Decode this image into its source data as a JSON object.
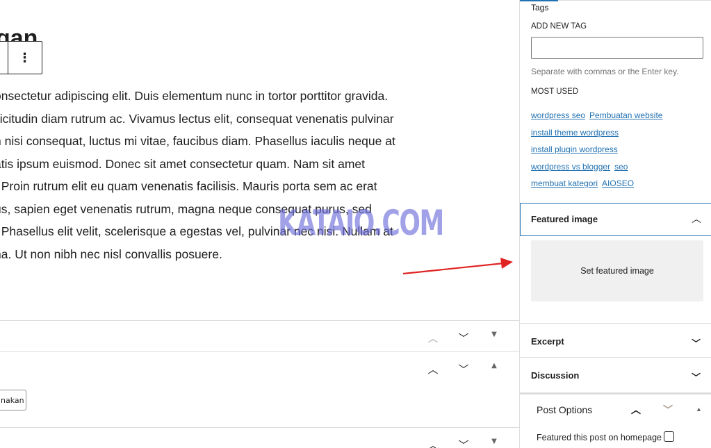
{
  "editor": {
    "title_fragment": "gan",
    "more_options_icon": "⋮",
    "paragraph_lines": [
      "onsectetur adipiscing elit. Duis elementum nunc in tortor porttitor gravida.",
      "llicitudin diam rutrum ac. Vivamus lectus elit, consequat venenatis pulvinar",
      "n nisi consequat, luctus mi vitae, faucibus diam. Phasellus iaculis neque at",
      "atis ipsum euismod. Donec sit amet consectetur quam. Nam sit amet",
      ". Proin rutrum elit eu quam venenatis facilisis. Mauris porta sem ac erat",
      "us, sapien eget venenatis rutrum, magna neque consequat purus, sed",
      ". Phasellus elit velit, scelerisque a egestas vel, pulvinar nec nisi. Nullam at",
      "na. Ut non nibh nec nisl convallis posuere."
    ],
    "watermark": "KATAIO.COM",
    "select_value": "nakan",
    "arrow_color": "#e02424"
  },
  "sidebar": {
    "tags_heading": "Tags",
    "add_new_tag_label": "ADD NEW TAG",
    "tag_input_value": "",
    "help_text": "Separate with commas or the Enter key.",
    "most_used_label": "MOST USED",
    "tag_rows": [
      [
        "wordpress seo",
        "Pembuatan website"
      ],
      [
        "install theme wordpress"
      ],
      [
        "install plugin wordpress"
      ],
      [
        "wordpress vs blogger",
        "seo"
      ],
      [
        "membuat kategori",
        "AIOSEO"
      ]
    ],
    "featured_image": {
      "title": "Featured image",
      "button": "Set featured image"
    },
    "excerpt": "Excerpt",
    "discussion": "Discussion",
    "post_options": {
      "title": "Post Options",
      "featured_label": "Featured this post on homepage",
      "featured_checked": false
    },
    "accent": "#2271b1"
  }
}
